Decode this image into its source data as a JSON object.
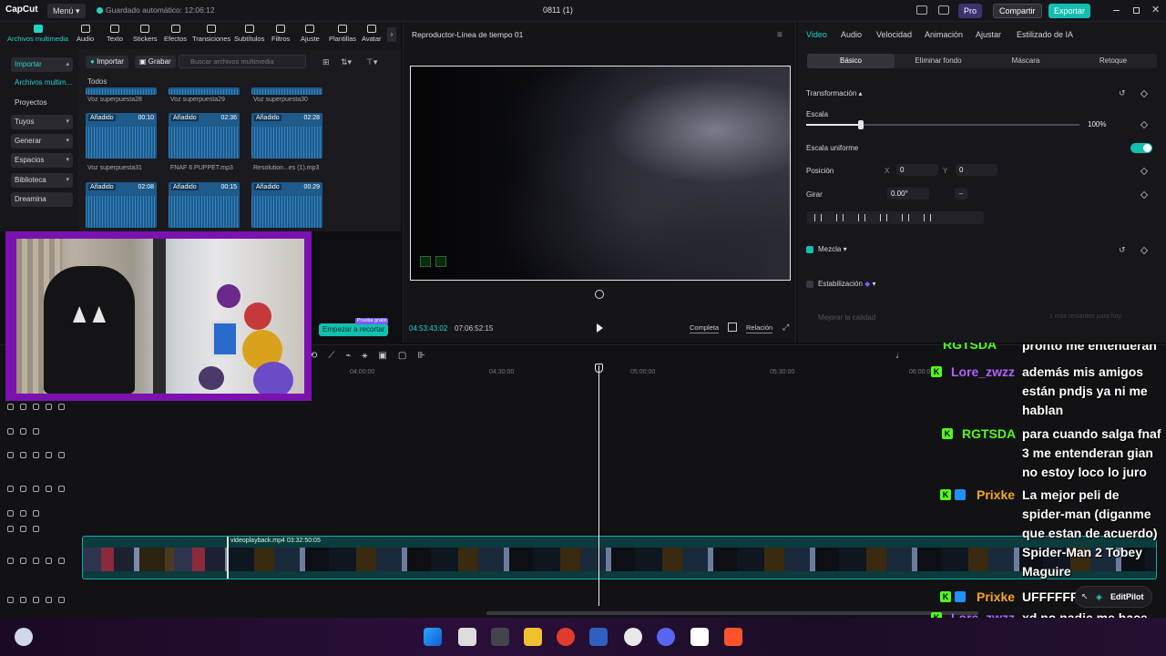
{
  "titlebar": {
    "app": "CapCut",
    "menu": "Menú",
    "autosave": "Guardado automático: 12:06:12",
    "document": "0811 (1)",
    "pro": "Pro",
    "share": "Compartir",
    "export": "Exportar"
  },
  "tools": [
    "Archivos multimedia",
    "Audio",
    "Texto",
    "Stickers",
    "Efectos",
    "Transiciones",
    "Subtítulos",
    "Filtros",
    "Ajuste",
    "Plantillas",
    "Avatar"
  ],
  "media_sidebar": {
    "import": "Importar",
    "items": [
      "Archivos multim...",
      "Proyectos secun...",
      "Tuyos",
      "Generar",
      "Espacios",
      "Biblioteca",
      "Dreamina"
    ]
  },
  "media": {
    "import_btn": "Importar",
    "record_btn": "Grabar",
    "search_placeholder": "Buscar archivos multimedia",
    "all_label": "Todos",
    "top_row": [
      "Voz superpuesta28",
      "Voz superpuesta29",
      "Voz superpuesta30"
    ],
    "items": [
      {
        "tag": "Añadido",
        "dur": "00:10",
        "name": "Voz superpuesta31"
      },
      {
        "tag": "Añadido",
        "dur": "02:36",
        "name": "FNAF 6 PUPPET.mp3"
      },
      {
        "tag": "Añadido",
        "dur": "02:28",
        "name": "Resolution...es (1).mp3"
      },
      {
        "tag": "Añadido",
        "dur": "02:08",
        "name": ""
      },
      {
        "tag": "Añadido",
        "dur": "00:15",
        "name": ""
      },
      {
        "tag": "Añadido",
        "dur": "00:29",
        "name": ""
      }
    ]
  },
  "start_crop": {
    "label": "Empezar a recortar",
    "badge": "Prueba gratis"
  },
  "player": {
    "title": "Reproductor-Línea de tiempo 01",
    "current": "04:53:43:02",
    "total": "07:06:52:15",
    "full_btn": "Completa",
    "ratio_btn": "Relación"
  },
  "props": {
    "tabs": [
      "Video",
      "Audio",
      "Velocidad",
      "Animación",
      "Ajustar",
      "Estilizado de IA"
    ],
    "subtabs": [
      "Básico",
      "Eliminar fondo",
      "Máscara",
      "Retoque"
    ],
    "transform": "Transformación",
    "scale": "Escala",
    "scale_value": "100%",
    "uniform_scale": "Escala uniforme",
    "position": "Posición",
    "pos_x_label": "X",
    "pos_x": "0",
    "pos_y_label": "Y",
    "pos_y": "0",
    "rotate": "Girar",
    "rotate_value": "0.00°",
    "blend": "Mezcla",
    "stabilize": "Estabilización",
    "improve": "Mejorar la calidad",
    "improve_hint": "1 más restantes para hoy"
  },
  "timeline": {
    "ticks": [
      "04:00:00",
      "04:30:00",
      "05:00:00",
      "05:30:00",
      "06:00:00"
    ],
    "clip_label": "videoplayback.mp4   03:32:50:05"
  },
  "chat": [
    {
      "name": "RGTSDA",
      "msg": "pronto me entenderán",
      "color": "#53fc18",
      "badges": 1
    },
    {
      "name": "Lore_zwzz",
      "msg": "además mis amigos están pndjs ya ni me hablan",
      "color": "#b061ff",
      "badges": 1
    },
    {
      "name": "RGTSDA",
      "msg": "para cuando salga fnaf 3 me entenderan gian no estoy loco lo juro",
      "color": "#53fc18",
      "badges": 1
    },
    {
      "name": "Prixke",
      "msg": "La mejor peli de spider-man (diganme que estan de acuerdo) Spider-Man 2 Tobey Maguire",
      "color": "#f5a623",
      "badges": 2
    },
    {
      "name": "Prixke",
      "msg": "UFFFFFFFF",
      "color": "#f5a623",
      "badges": 2
    },
    {
      "name": "Lore_zwzz",
      "msg": "xd no nadie me hace caso gian",
      "color": "#b061ff",
      "badges": 1
    }
  ],
  "editpilot": "EditPilot",
  "colors": {
    "accent": "#22d3c5",
    "webcam_border": "#7b12b0",
    "kick": "#53fc18"
  }
}
